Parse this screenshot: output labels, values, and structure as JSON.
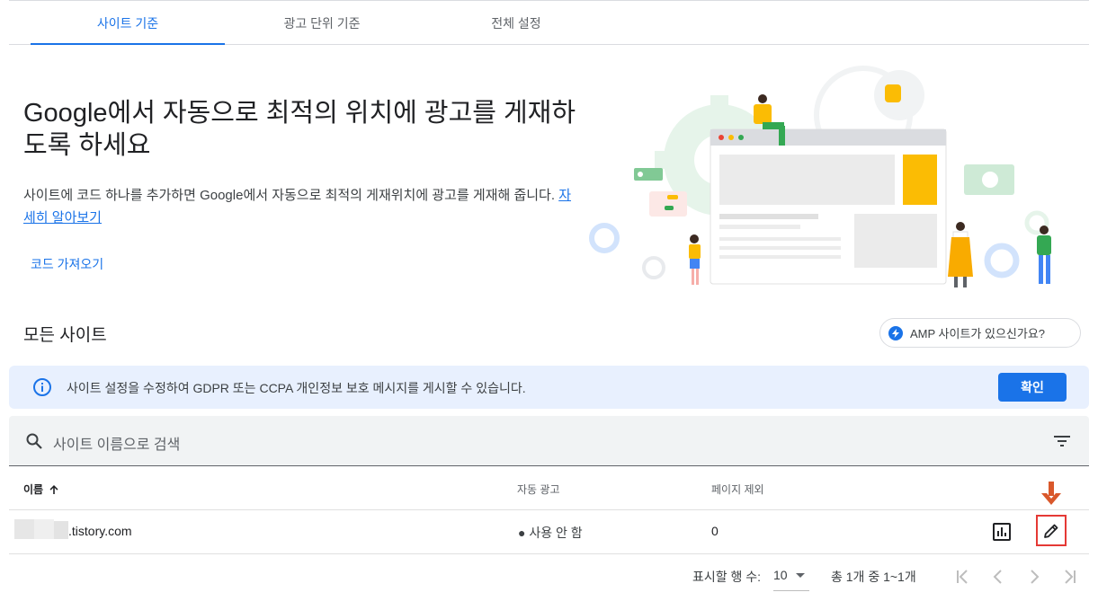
{
  "tabs": [
    {
      "label": "사이트 기준",
      "active": true
    },
    {
      "label": "광고 단위 기준",
      "active": false
    },
    {
      "label": "전체 설정",
      "active": false
    }
  ],
  "hero": {
    "title": "Google에서 자동으로 최적의 위치에 광고를 게재하도록 하세요",
    "desc": "사이트에 코드 하나를 추가하면 Google에서 자동으로 최적의 게재위치에 광고를 게재해 줍니다. ",
    "learn_more": "자세히 알아보기",
    "code_link": "코드 가져오기"
  },
  "sites_section": {
    "title": "모든 사이트",
    "amp_button": "AMP 사이트가 있으신가요?"
  },
  "banner": {
    "message": "사이트 설정을 수정하여 GDPR 또는 CCPA 개인정보 보호 메시지를 게시할 수 있습니다.",
    "button": "확인"
  },
  "search": {
    "placeholder": "사이트 이름으로 검색"
  },
  "table": {
    "headers": [
      "이름",
      "자동 광고",
      "페이지 제외"
    ],
    "rows": [
      {
        "site": ".tistory.com",
        "auto_ads": "사용 안 함",
        "excluded_pages": "0"
      }
    ]
  },
  "pagination": {
    "rows_label": "표시할 행 수:",
    "rows_per_page": "10",
    "range": "총 1개 중 1~1개"
  },
  "colors": {
    "accent": "#1a73e8",
    "banner_bg": "#e8f0fe",
    "highlight": "#e53935",
    "arrow": "#d9582b"
  },
  "icons": [
    "info-icon",
    "search-icon",
    "filter-icon",
    "sort-arrow-up-icon",
    "bar-chart-icon",
    "pencil-icon",
    "bolt-icon",
    "first-page-icon",
    "prev-page-icon",
    "next-page-icon",
    "last-page-icon",
    "down-arrow-icon"
  ]
}
